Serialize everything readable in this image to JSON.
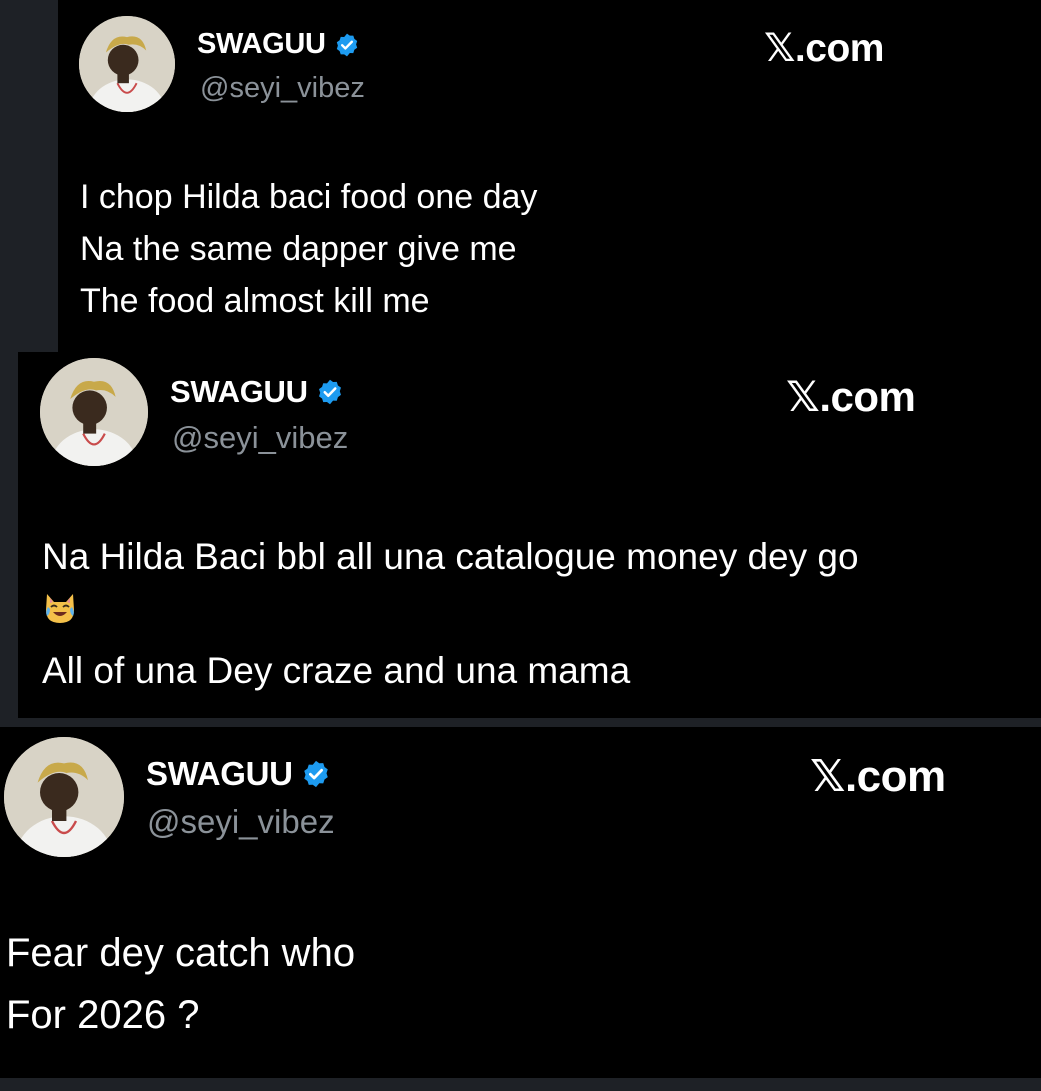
{
  "brand_label": "𝕏.com",
  "colors": {
    "card_background": "#000000",
    "page_background": "#1e2126",
    "text_primary": "#ffffff",
    "text_secondary": "#8b9299",
    "verified_badge": "#1d9bf0"
  },
  "posts": [
    {
      "author": {
        "name": "SWAGUU",
        "handle": "@seyi_vibez",
        "verified": true,
        "avatar_icon": "avatar-photo"
      },
      "lines": [
        "I chop Hilda baci food one day",
        "Na the same dapper give me",
        "The food almost kill me"
      ]
    },
    {
      "author": {
        "name": "SWAGUU",
        "handle": "@seyi_vibez",
        "verified": true,
        "avatar_icon": "avatar-photo"
      },
      "lines": [
        "Na Hilda Baci bbl all una catalogue money dey go",
        "All of una Dey craze and una mama"
      ],
      "emoji": "cat-with-tears-of-joy"
    },
    {
      "author": {
        "name": "SWAGUU",
        "handle": "@seyi_vibez",
        "verified": true,
        "avatar_icon": "avatar-photo"
      },
      "lines": [
        "Fear dey catch who",
        "For 2026 ?"
      ]
    }
  ]
}
